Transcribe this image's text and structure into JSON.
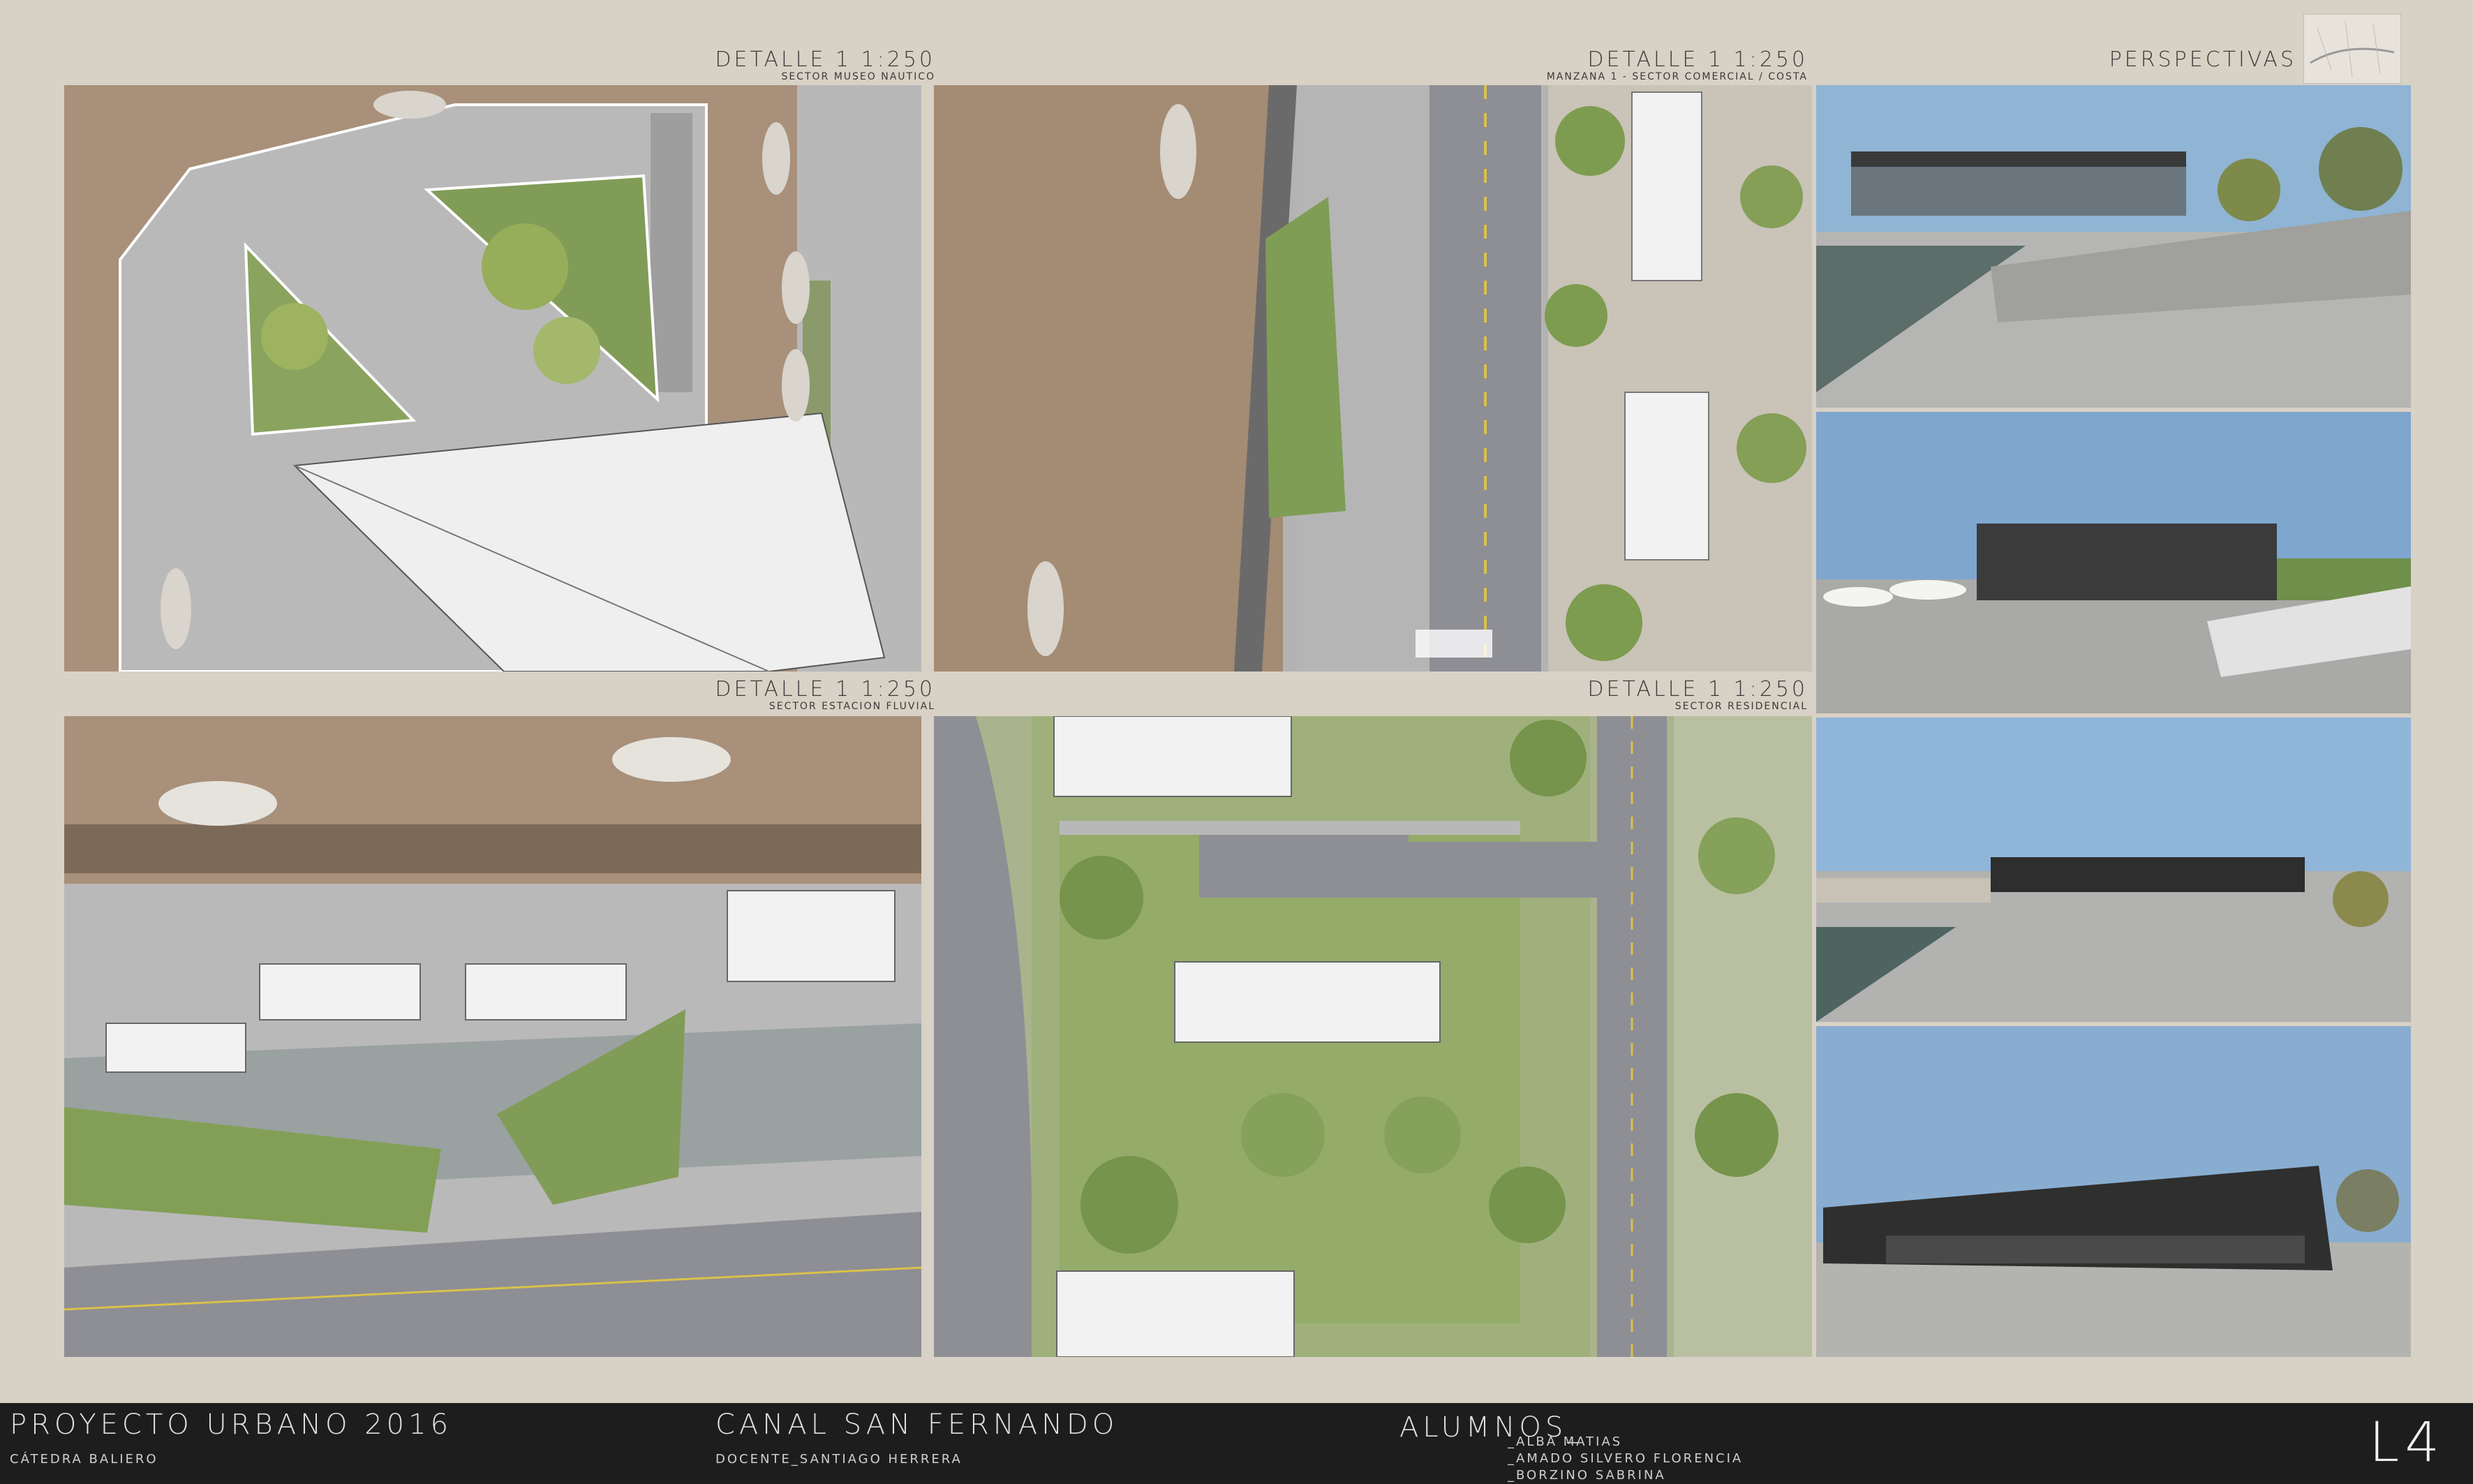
{
  "panels": {
    "detail1": {
      "title": "DETALLE 1 1:250",
      "subtitle": "SECTOR MUSEO NAUTICO"
    },
    "detail2": {
      "title": "DETALLE 1 1:250",
      "subtitle": "MANZANA 1 - SECTOR COMERCIAL / COSTA"
    },
    "perspectives": {
      "title": "PERSPECTIVAS"
    },
    "detail3": {
      "title": "DETALLE 1 1:250",
      "subtitle": "SECTOR ESTACION FLUVIAL"
    },
    "detail4": {
      "title": "DETALLE 1 1:250",
      "subtitle": "SECTOR RESIDENCIAL"
    }
  },
  "footer": {
    "project": "PROYECTO URBANO 2016",
    "chair": "CÁTEDRA BALIERO",
    "site": "CANAL SAN FERNANDO",
    "teacher": "DOCENTE_SANTIAGO HERRERA",
    "students_heading": "ALUMNOS_",
    "students": [
      "_ALBA MATIAS",
      "_AMADO SILVERO FLORENCIA",
      "_BORZINO SABRINA"
    ],
    "sheet": "L4"
  },
  "colors": {
    "water": "#a8907a",
    "paving": "#b9b9b9",
    "road": "#8e8e95",
    "grass": "#8da86a",
    "tree": "#7e9c4f",
    "roof": "#f2f2f2",
    "sky": "#8fb4d4",
    "footer": "#1d1d1d"
  }
}
